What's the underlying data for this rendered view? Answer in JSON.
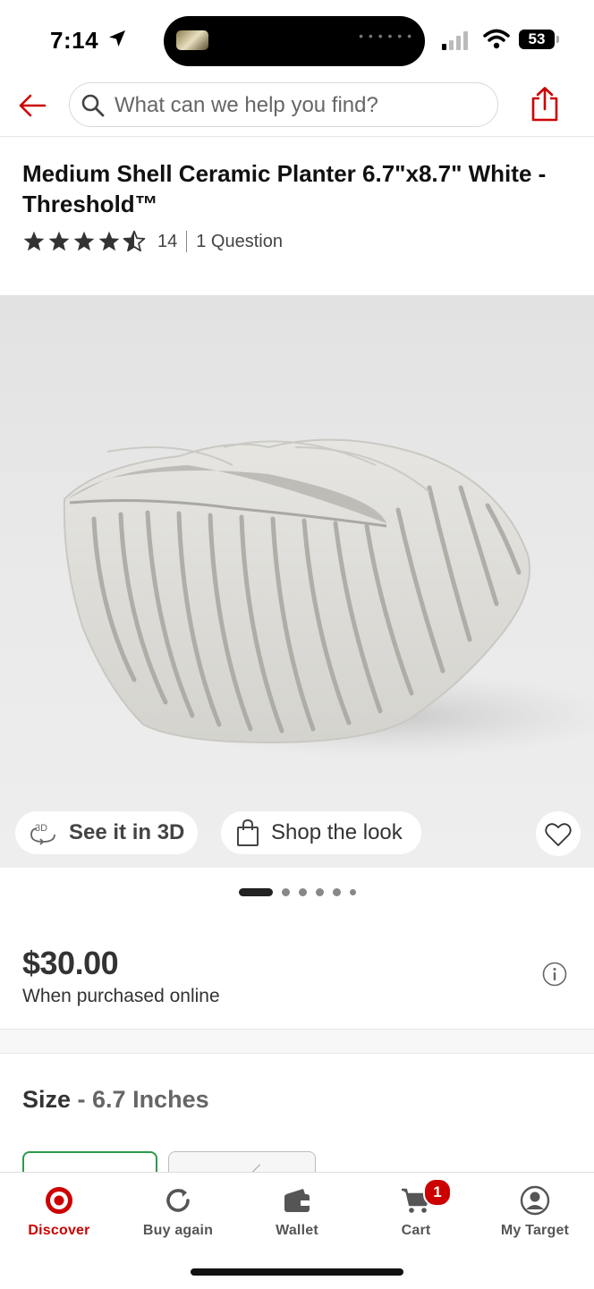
{
  "status_bar": {
    "time": "7:14",
    "battery": "53"
  },
  "header": {
    "back_icon": "arrow-left-icon",
    "search": {
      "placeholder": "What can we help you find?",
      "value": ""
    },
    "share_icon": "share-icon"
  },
  "product": {
    "title": "Medium Shell Ceramic Planter 6.7\"x8.7\" White - Threshold™",
    "rating_stars": 4.5,
    "rating_count": "14",
    "questions": "1 Question"
  },
  "hero": {
    "see_3d_label": "See it in 3D",
    "shop_look_label": "Shop the look",
    "carousel_dots": 6,
    "active_dot": 1
  },
  "pricing": {
    "price": "$30.00",
    "note": "When purchased online"
  },
  "size": {
    "label": "Size",
    "separator": " - ",
    "value": "6.7 Inches"
  },
  "bottom_nav": {
    "items": [
      {
        "label": "Discover",
        "icon": "target-logo-icon",
        "active": true
      },
      {
        "label": "Buy again",
        "icon": "refresh-icon",
        "active": false
      },
      {
        "label": "Wallet",
        "icon": "wallet-icon",
        "active": false
      },
      {
        "label": "Cart",
        "icon": "cart-icon",
        "active": false,
        "badge": "1"
      },
      {
        "label": "My Target",
        "icon": "account-icon",
        "active": false
      }
    ]
  },
  "colors": {
    "brand_red": "#cc0000",
    "selected_green": "#2e9a49"
  }
}
